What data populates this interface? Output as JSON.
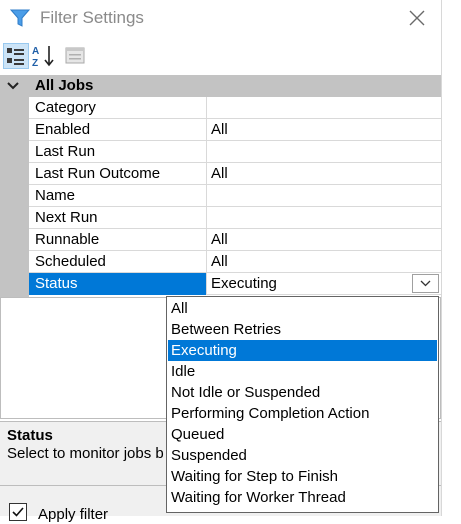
{
  "window": {
    "title": "Filter Settings",
    "filter_icon": "filter-icon",
    "close_icon": "close-icon"
  },
  "toolbar": {
    "buttons": [
      "categorized-icon",
      "alphabetical-sort-icon",
      "property-pages-icon"
    ]
  },
  "grid": {
    "category": "All Jobs",
    "rows": [
      {
        "name": "Category",
        "value": ""
      },
      {
        "name": "Enabled",
        "value": "All"
      },
      {
        "name": "Last Run",
        "value": ""
      },
      {
        "name": "Last Run Outcome",
        "value": "All"
      },
      {
        "name": "Name",
        "value": ""
      },
      {
        "name": "Next Run",
        "value": ""
      },
      {
        "name": "Runnable",
        "value": "All"
      },
      {
        "name": "Scheduled",
        "value": "All"
      },
      {
        "name": "Status",
        "value": "Executing"
      }
    ],
    "selected_row": "Status"
  },
  "dropdown": {
    "selected": "Executing",
    "options": [
      "All",
      "Between Retries",
      "Executing",
      "Idle",
      "Not Idle or Suspended",
      "Performing Completion Action",
      "Queued",
      "Suspended",
      "Waiting for Step to Finish",
      "Waiting for Worker Thread"
    ]
  },
  "description": {
    "title": "Status",
    "text": "Select to monitor jobs b"
  },
  "bottom": {
    "apply_filter_label": "Apply filter",
    "apply_filter_checked": true
  },
  "colors": {
    "selection": "#0078d7",
    "category_bg": "#c3c3c3",
    "description_bg": "#f0f0f0",
    "accent_icon": "#3a8ee6"
  }
}
